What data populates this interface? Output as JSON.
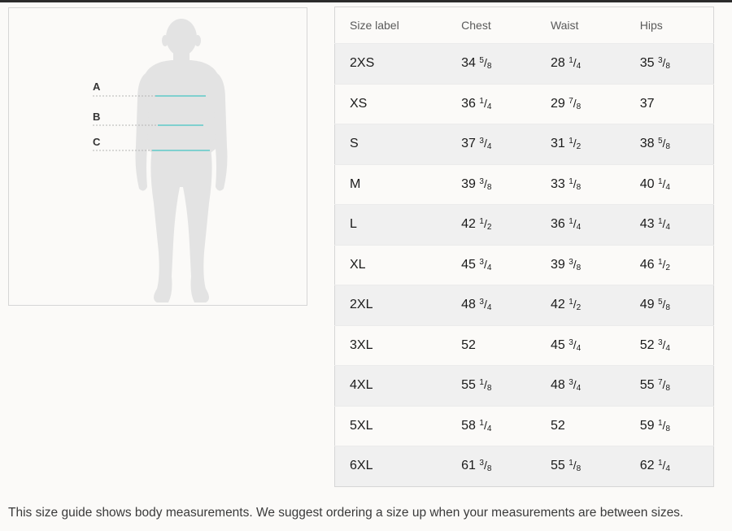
{
  "figure": {
    "labels": [
      "A",
      "B",
      "C"
    ],
    "accent_color": "#7fd0cf",
    "silhouette_color": "#e3e3e3"
  },
  "table": {
    "headers": [
      "Size label",
      "Chest",
      "Waist",
      "Hips"
    ],
    "rows": [
      [
        {
          "w": "",
          "n": "",
          "d": "",
          "t": "2XS"
        },
        {
          "w": "34",
          "n": "5",
          "d": "8"
        },
        {
          "w": "28",
          "n": "1",
          "d": "4"
        },
        {
          "w": "35",
          "n": "3",
          "d": "8"
        }
      ],
      [
        {
          "w": "",
          "n": "",
          "d": "",
          "t": "XS"
        },
        {
          "w": "36",
          "n": "1",
          "d": "4"
        },
        {
          "w": "29",
          "n": "7",
          "d": "8"
        },
        {
          "w": "37",
          "n": "",
          "d": ""
        }
      ],
      [
        {
          "w": "",
          "n": "",
          "d": "",
          "t": "S"
        },
        {
          "w": "37",
          "n": "3",
          "d": "4"
        },
        {
          "w": "31",
          "n": "1",
          "d": "2"
        },
        {
          "w": "38",
          "n": "5",
          "d": "8"
        }
      ],
      [
        {
          "w": "",
          "n": "",
          "d": "",
          "t": "M"
        },
        {
          "w": "39",
          "n": "3",
          "d": "8"
        },
        {
          "w": "33",
          "n": "1",
          "d": "8"
        },
        {
          "w": "40",
          "n": "1",
          "d": "4"
        }
      ],
      [
        {
          "w": "",
          "n": "",
          "d": "",
          "t": "L"
        },
        {
          "w": "42",
          "n": "1",
          "d": "2"
        },
        {
          "w": "36",
          "n": "1",
          "d": "4"
        },
        {
          "w": "43",
          "n": "1",
          "d": "4"
        }
      ],
      [
        {
          "w": "",
          "n": "",
          "d": "",
          "t": "XL"
        },
        {
          "w": "45",
          "n": "3",
          "d": "4"
        },
        {
          "w": "39",
          "n": "3",
          "d": "8"
        },
        {
          "w": "46",
          "n": "1",
          "d": "2"
        }
      ],
      [
        {
          "w": "",
          "n": "",
          "d": "",
          "t": "2XL"
        },
        {
          "w": "48",
          "n": "3",
          "d": "4"
        },
        {
          "w": "42",
          "n": "1",
          "d": "2"
        },
        {
          "w": "49",
          "n": "5",
          "d": "8"
        }
      ],
      [
        {
          "w": "",
          "n": "",
          "d": "",
          "t": "3XL"
        },
        {
          "w": "52",
          "n": "",
          "d": ""
        },
        {
          "w": "45",
          "n": "3",
          "d": "4"
        },
        {
          "w": "52",
          "n": "3",
          "d": "4"
        }
      ],
      [
        {
          "w": "",
          "n": "",
          "d": "",
          "t": "4XL"
        },
        {
          "w": "55",
          "n": "1",
          "d": "8"
        },
        {
          "w": "48",
          "n": "3",
          "d": "4"
        },
        {
          "w": "55",
          "n": "7",
          "d": "8"
        }
      ],
      [
        {
          "w": "",
          "n": "",
          "d": "",
          "t": "5XL"
        },
        {
          "w": "58",
          "n": "1",
          "d": "4"
        },
        {
          "w": "52",
          "n": "",
          "d": ""
        },
        {
          "w": "59",
          "n": "1",
          "d": "8"
        }
      ],
      [
        {
          "w": "",
          "n": "",
          "d": "",
          "t": "6XL"
        },
        {
          "w": "61",
          "n": "3",
          "d": "8"
        },
        {
          "w": "55",
          "n": "1",
          "d": "8"
        },
        {
          "w": "62",
          "n": "1",
          "d": "4"
        }
      ]
    ]
  },
  "footnote": "This size guide shows body measurements. We suggest ordering a size up when your measurements are between sizes."
}
